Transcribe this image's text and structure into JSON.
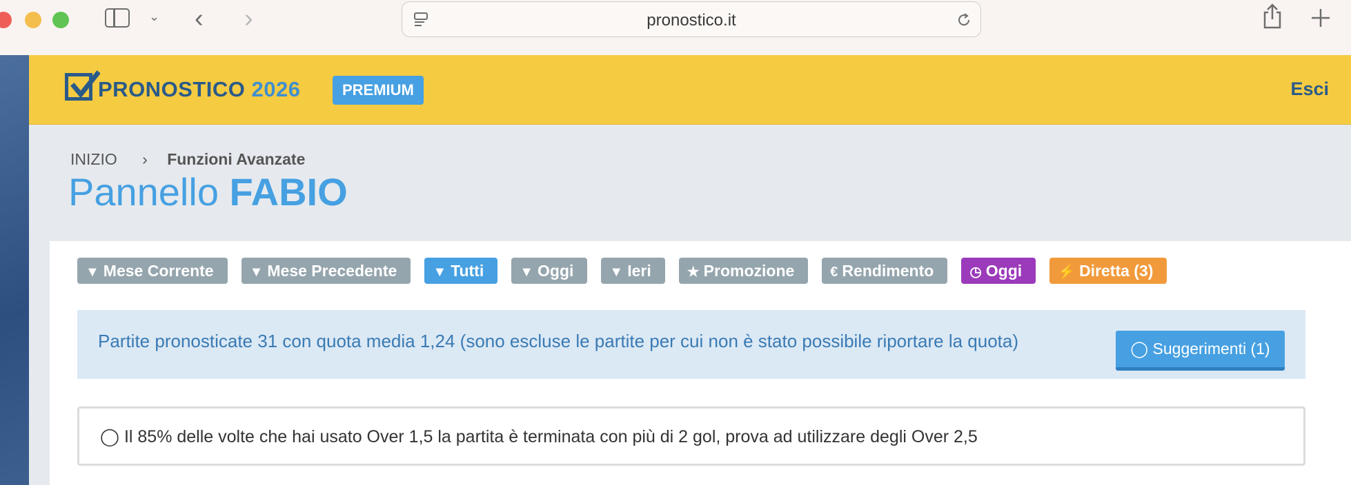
{
  "browser": {
    "url": "pronostico.it"
  },
  "header": {
    "logo_main": "PRONOSTICO",
    "logo_year": "2026",
    "badge": "PREMIUM",
    "logout": "Esci"
  },
  "breadcrumb": {
    "home": "INIZIO",
    "current": "Funzioni Avanzate"
  },
  "page": {
    "title_prefix": "Pannello",
    "title_name": "FABIO"
  },
  "filters": [
    {
      "label": "Mese Corrente",
      "icon": "filter-icon"
    },
    {
      "label": "Mese Precedente",
      "icon": "filter-icon"
    },
    {
      "label": "Tutti",
      "icon": "filter-icon",
      "active": true
    },
    {
      "label": "Oggi",
      "icon": "filter-icon"
    },
    {
      "label": "Ieri",
      "icon": "filter-icon"
    },
    {
      "label": "Promozione",
      "icon": "trophy-icon"
    },
    {
      "label": "Rendimento",
      "icon": "euro-icon"
    },
    {
      "label": "Oggi",
      "icon": "clock-icon",
      "color": "#9b3aba"
    },
    {
      "label": "Diretta (3)",
      "icon": "bolt-icon",
      "color": "#f19a3c"
    }
  ],
  "info": {
    "text": "Partite pronosticate 31 con quota media 1,24 (sono escluse le partite per cui non è stato possibile riportare la quota)",
    "button": "Suggerimenti (1)"
  },
  "tip": {
    "text": "Il 85% delle volte che hai usato Over 1,5 la partita è terminata con più di 2 gol, prova ad utilizzare degli Over 2,5"
  }
}
